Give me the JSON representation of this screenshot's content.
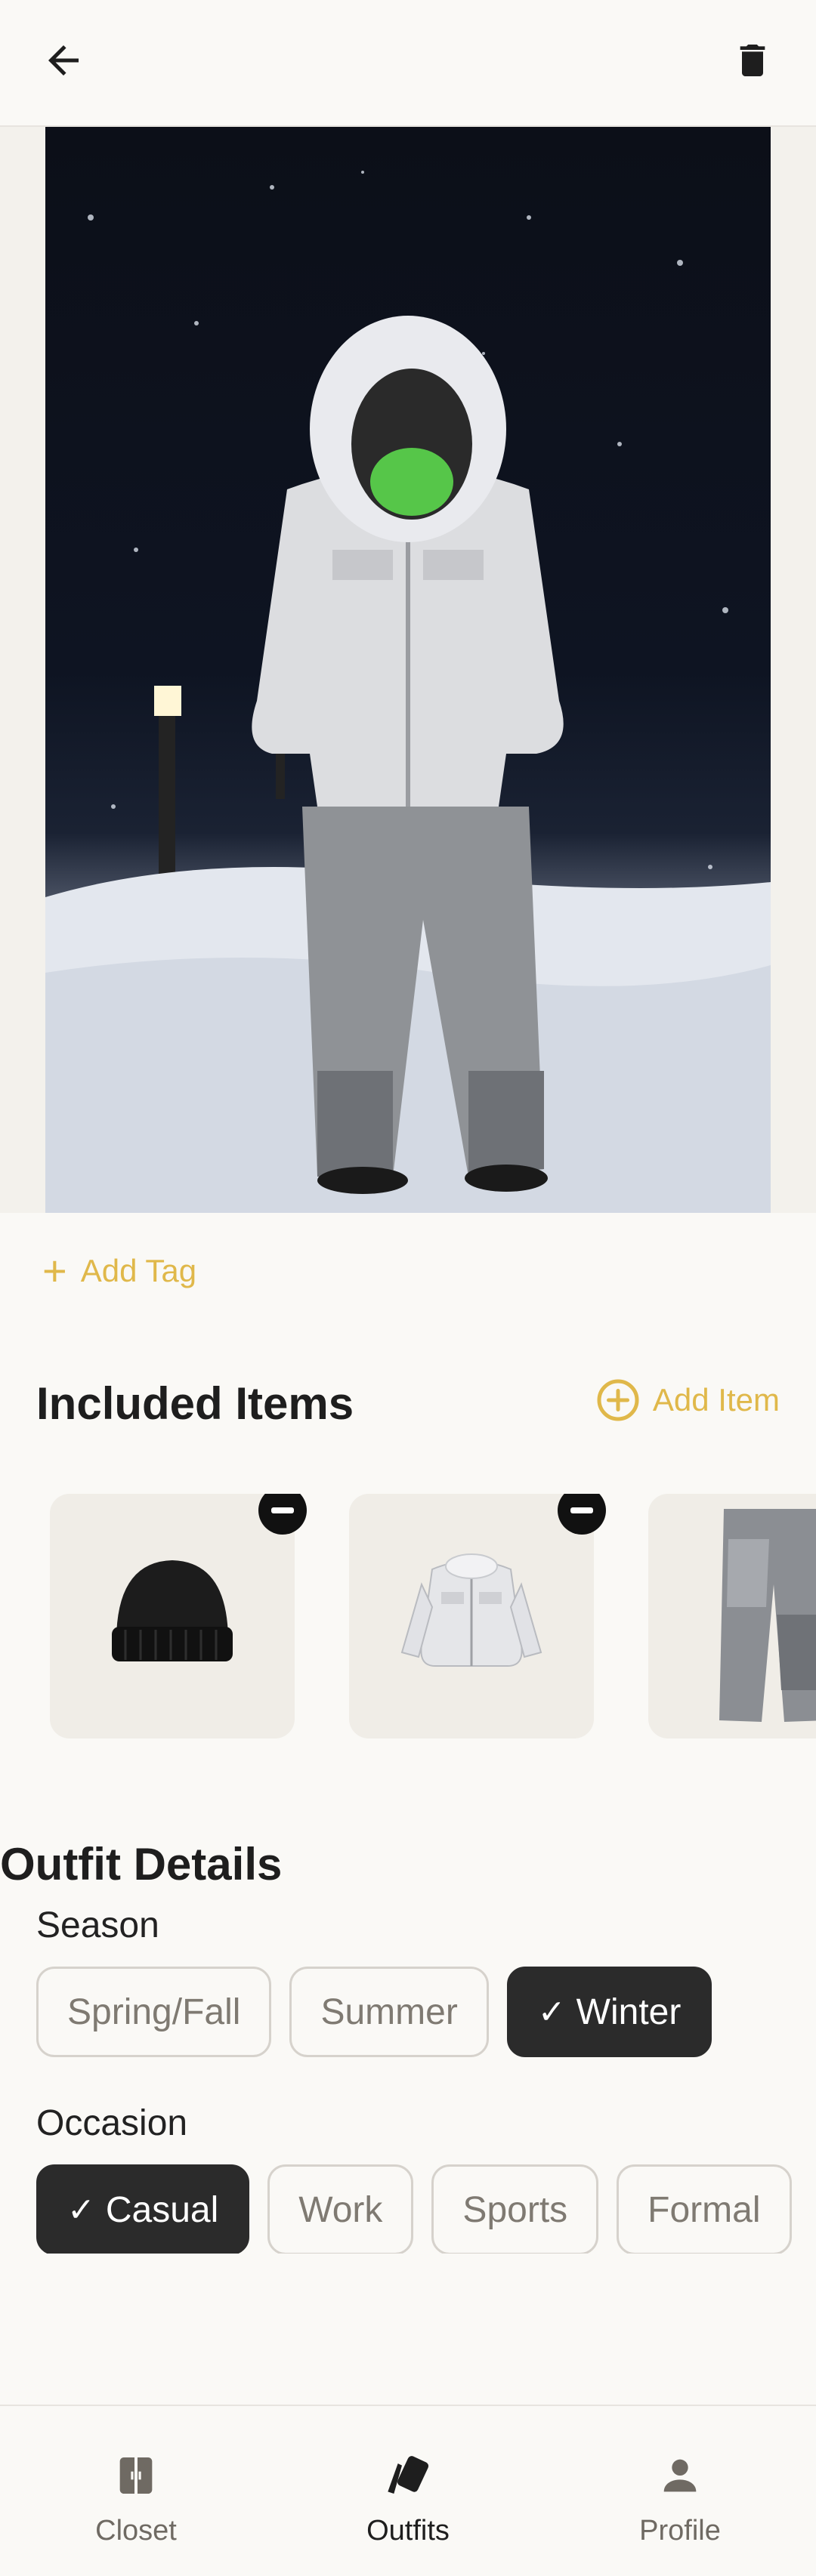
{
  "header": {
    "back_icon": "arrow-left-icon",
    "delete_icon": "trash-icon"
  },
  "outfit_photo": {
    "alt": "Outfit photo"
  },
  "tags": {
    "add_tag_label": "Add Tag"
  },
  "included_items": {
    "title": "Included Items",
    "add_item_label": "Add Item",
    "items": [
      {
        "kind": "beanie",
        "removable": true
      },
      {
        "kind": "jacket",
        "removable": true
      },
      {
        "kind": "pants",
        "removable": false
      }
    ]
  },
  "details": {
    "title": "Outfit Details",
    "season_label": "Season",
    "season_options": [
      "Spring/Fall",
      "Summer",
      "Winter"
    ],
    "season_selected": "Winter",
    "occasion_label": "Occasion",
    "occasion_options": [
      "Casual",
      "Work",
      "Sports",
      "Formal"
    ],
    "occasion_selected": "Casual"
  },
  "bottom_nav": {
    "items": [
      {
        "label": "Closet",
        "icon": "wardrobe-icon"
      },
      {
        "label": "Outfits",
        "icon": "cards-icon",
        "active": true
      },
      {
        "label": "Profile",
        "icon": "person-icon"
      }
    ]
  },
  "colors": {
    "accent": "#E0B84A",
    "chip_selected_bg": "#2B2B2B",
    "background": "#FAF9F6"
  }
}
